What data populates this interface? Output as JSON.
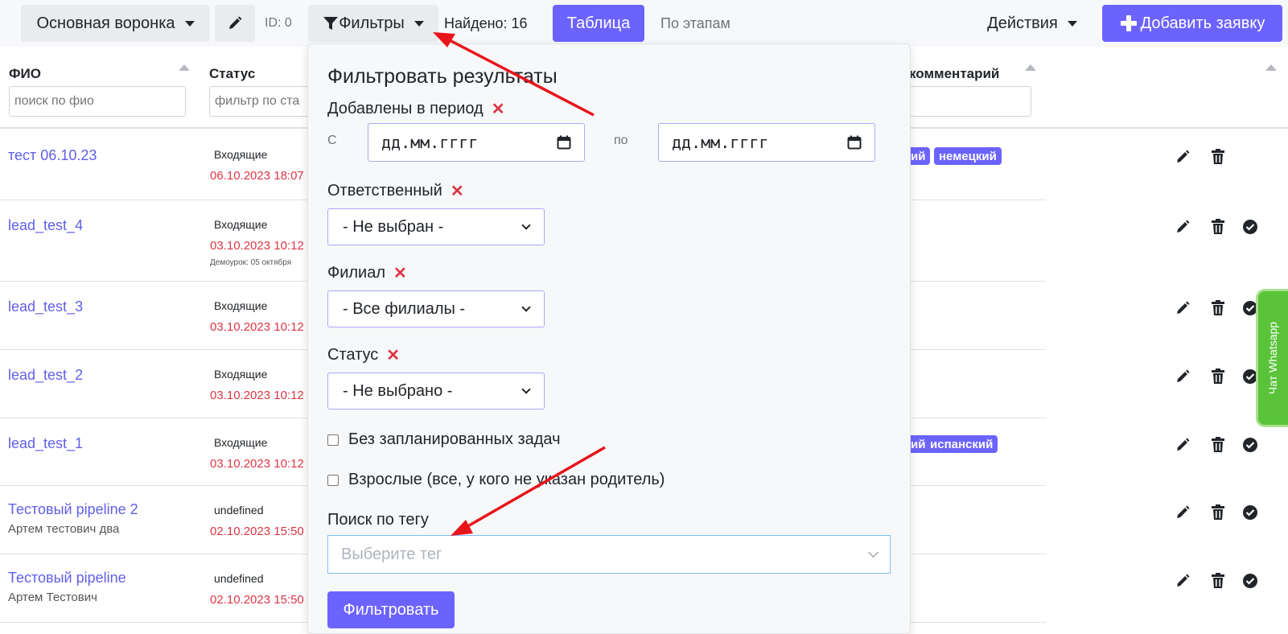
{
  "toolbar": {
    "funnel_label": "Основная воронка",
    "id_text": "ID: 0",
    "filters_label": "Фильтры",
    "found_text": "Найдено: 16",
    "table_label": "Таблица",
    "stages_label": "По этапам",
    "actions_label": "Действия",
    "add_label": "Добавить заявку"
  },
  "table": {
    "headers": {
      "fio": "ФИО",
      "status": "Статус",
      "comment": "комментарий"
    },
    "fio_placeholder": "поиск по фио",
    "status_placeholder": "фильтр по ста",
    "rows": [
      {
        "name": "тест 06.10.23",
        "sub": "",
        "status": "Входящие",
        "date": "06.10.2023 18:07",
        "note": "",
        "tags": [
          "ий",
          "немецкий"
        ]
      },
      {
        "name": "lead_test_4",
        "sub": "",
        "status": "Входящие",
        "date": "03.10.2023 10:12",
        "note": "Демоурок: 05 октября",
        "tags": []
      },
      {
        "name": "lead_test_3",
        "sub": "",
        "status": "Входящие",
        "date": "03.10.2023 10:12",
        "note": "",
        "tags": []
      },
      {
        "name": "lead_test_2",
        "sub": "",
        "status": "Входящие",
        "date": "03.10.2023 10:12",
        "note": "",
        "tags": []
      },
      {
        "name": "lead_test_1",
        "sub": "",
        "status": "Входящие",
        "date": "03.10.2023 10:12",
        "note": "",
        "tags": [
          "ий",
          "испанский"
        ]
      },
      {
        "name": "Тестовый pipeline 2",
        "sub": "Артем тестович два",
        "status": "undefined",
        "date": "02.10.2023 15:50",
        "note": "",
        "tags": []
      },
      {
        "name": "Тестовый pipeline",
        "sub": "Артем Тестович",
        "status": "undefined",
        "date": "02.10.2023 15:50",
        "note": "",
        "tags": []
      }
    ]
  },
  "filter": {
    "title": "Фильтровать результаты",
    "period_label": "Добавлены в период",
    "from_label": "С",
    "to_label": "по",
    "date_placeholder": "дд.мм.гггг",
    "responsible_label": "Ответственный",
    "responsible_value": "- Не выбран -",
    "branch_label": "Филиал",
    "branch_value": "- Все филиалы -",
    "status_label": "Статус",
    "status_value": "- Не выбрано -",
    "no_tasks_label": "Без запланированных задач",
    "adults_label": "Взрослые (все, у кого не указан родитель)",
    "tag_search_label": "Поиск по тегу",
    "tag_placeholder": "Выберите тег",
    "submit_label": "Фильтровать",
    "clear_mark": "✕"
  },
  "whatsapp": {
    "label": "Чат Whatsapp"
  },
  "colors": {
    "accent": "#6c63ff",
    "link": "#6060e8",
    "danger": "#dc3545",
    "whatsapp": "#5ac33a",
    "arrow": "#e8141b"
  }
}
